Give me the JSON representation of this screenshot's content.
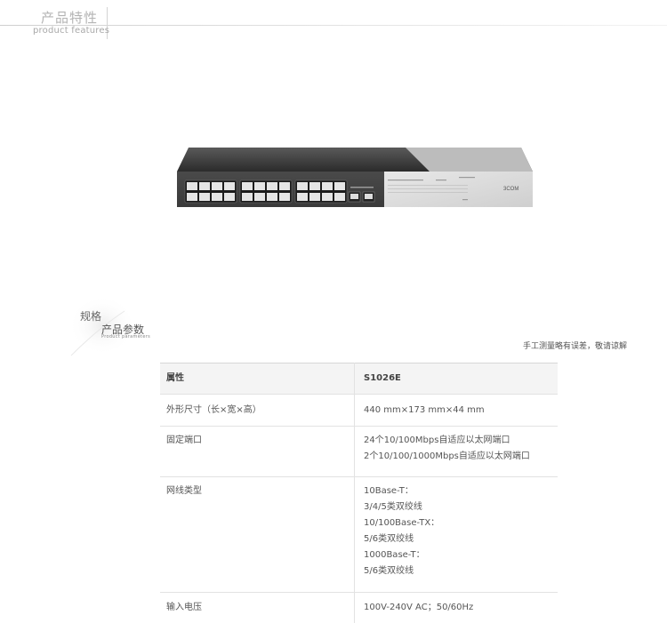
{
  "header": {
    "title": "产品特性",
    "subtitle": "product features"
  },
  "product": {
    "brand": "3COM",
    "image_icon": "network-switch-image"
  },
  "spec_section": {
    "title": "规格",
    "subtitle": "产品参数",
    "subtitle_en": "Product parameters",
    "note": "手工测量略有误差，敬请谅解"
  },
  "spec_table": {
    "header": {
      "attr": "属性",
      "value": "S1026E"
    },
    "rows": [
      {
        "attr": "外形尺寸（长×宽×高）",
        "lines": [
          "440 mm×173 mm×44 mm"
        ]
      },
      {
        "attr": "固定端口",
        "lines": [
          "24个10/100Mbps自适应以太网端口",
          "2个10/100/1000Mbps自适应以太网端口"
        ]
      },
      {
        "attr": "网线类型",
        "lines": [
          "10Base-T：",
          "3/4/5类双绞线",
          "10/100Base-TX：",
          "5/6类双绞线",
          "1000Base-T：",
          "5/6类双绞线"
        ]
      },
      {
        "attr": "输入电压",
        "lines": [
          "100V-240V AC；50/60Hz"
        ]
      }
    ]
  },
  "colors": {
    "header_text": "#b4b4b4",
    "table_header_bg": "#f4f4f4",
    "switch_body": "#3a3a3a",
    "switch_panel": "#d9d9d9"
  }
}
